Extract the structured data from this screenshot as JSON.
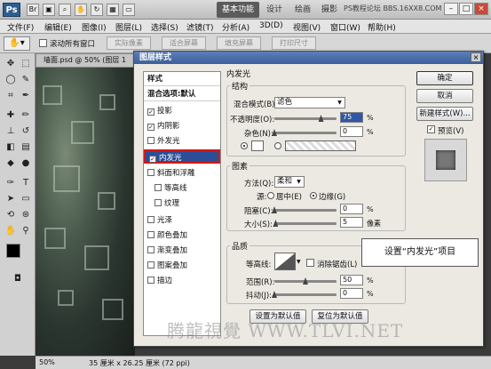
{
  "titlebar": {
    "logo": "Ps",
    "workspace_tabs": [
      "基本功能",
      "设计",
      "绘画",
      "摄影"
    ],
    "watermark_top": "PS教程论坛 BBS.16XX8.COM"
  },
  "menu": [
    "文件(F)",
    "编辑(E)",
    "图像(I)",
    "图层(L)",
    "选择(S)",
    "滤镜(T)",
    "分析(A)",
    "3D(D)",
    "视图(V)",
    "窗口(W)",
    "帮助(H)"
  ],
  "options": {
    "scroll_all": "滚动所有窗口",
    "buttons": [
      "实际像素",
      "适合屏幕",
      "填充屏幕",
      "打印尺寸"
    ]
  },
  "document": {
    "tab": "墙面.psd @ 50% (图层 1",
    "zoom": "50%",
    "size": "35 厘米 x 26.25 厘米 (72 ppi)"
  },
  "dialog": {
    "title": "图层样式",
    "styles_header": "样式",
    "blend_options": "混合选项:默认",
    "styles": [
      {
        "label": "投影",
        "checked": true
      },
      {
        "label": "内阴影",
        "checked": true
      },
      {
        "label": "外发光",
        "checked": false
      },
      {
        "label": "内发光",
        "checked": true
      },
      {
        "label": "斜面和浮雕",
        "checked": false
      },
      {
        "label": "等高线",
        "checked": false
      },
      {
        "label": "纹理",
        "checked": false
      },
      {
        "label": "光泽",
        "checked": false
      },
      {
        "label": "颜色叠加",
        "checked": false
      },
      {
        "label": "渐变叠加",
        "checked": false
      },
      {
        "label": "图案叠加",
        "checked": false
      },
      {
        "label": "描边",
        "checked": false
      }
    ],
    "panel_title": "内发光",
    "structure": {
      "title": "结构",
      "blend_mode_label": "混合模式(B):",
      "blend_mode": "滤色",
      "opacity_label": "不透明度(O):",
      "opacity": "75",
      "opacity_fraction": 0.75,
      "noise_label": "杂色(N):",
      "noise": "0",
      "noise_fraction": 0
    },
    "elements": {
      "title": "图素",
      "method_label": "方法(Q):",
      "method": "柔和",
      "source_label": "源:",
      "center": "居中(E)",
      "edge": "边缘(G)",
      "choke_label": "阻塞(C):",
      "choke": "0",
      "choke_fraction": 0,
      "size_label": "大小(S):",
      "size": "5",
      "size_fraction": 0.02,
      "size_unit": "像素"
    },
    "quality": {
      "title": "品质",
      "contour_label": "等高线:",
      "antialias": "消除锯齿(L)",
      "range_label": "范围(R):",
      "range": "50",
      "range_fraction": 0.5,
      "jitter_label": "抖动(J):",
      "jitter": "0",
      "jitter_fraction": 0
    },
    "percent": "%",
    "buttons": {
      "ok": "确定",
      "cancel": "取消",
      "new_style": "新建样式(W)...",
      "preview": "预览(V)",
      "set_default": "设置为默认值",
      "reset_default": "复位为默认值"
    }
  },
  "callout": "设置“内发光”项目",
  "watermark": "腾龍視覺 WWW.TLVI.NET",
  "colors": {
    "selection": "#2c4e96",
    "highlight_border": "#d11818",
    "title_bar": "#3a5f9b"
  }
}
